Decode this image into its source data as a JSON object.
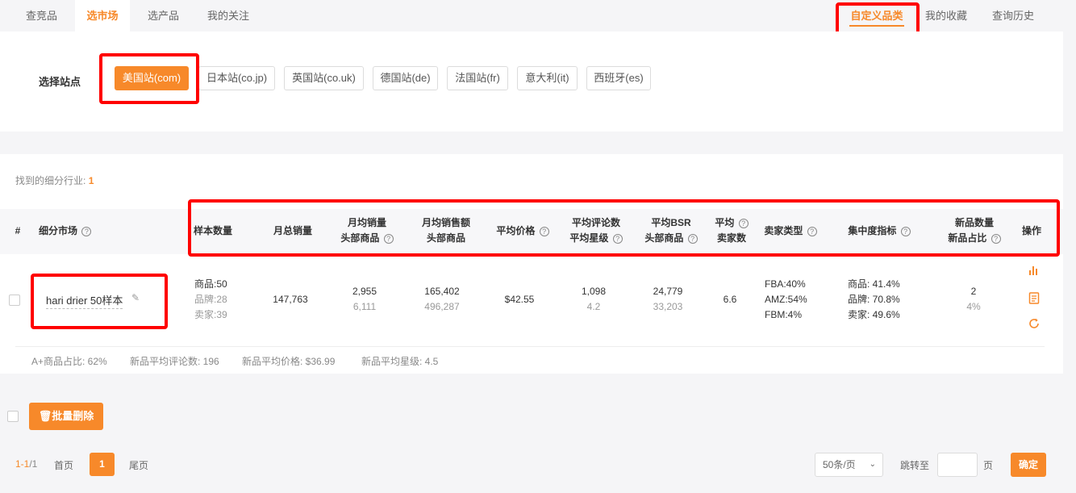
{
  "nav": {
    "tabs": [
      "查竞品",
      "选市场",
      "选产品",
      "我的关注"
    ],
    "right_tabs": [
      "自定义品类",
      "我的收藏",
      "查询历史"
    ]
  },
  "site": {
    "label": "选择站点",
    "options": [
      "美国站(com)",
      "日本站(co.jp)",
      "英国站(co.uk)",
      "德国站(de)",
      "法国站(fr)",
      "意大利(it)",
      "西班牙(es)"
    ],
    "selected": "美国站(com)"
  },
  "results": {
    "found_label": "找到的细分行业:",
    "found_count": "1"
  },
  "table": {
    "headers": {
      "index": "#",
      "market": "细分市场",
      "sample": "样本数量",
      "monthly_sales": "月总销量",
      "avg_sales_1": "月均销量",
      "avg_sales_2": "头部商品",
      "avg_revenue_1": "月均销售额",
      "avg_revenue_2": "头部商品",
      "avg_price": "平均价格",
      "avg_reviews_1": "平均评论数",
      "avg_reviews_2": "平均星级",
      "avg_bsr_1": "平均BSR",
      "avg_bsr_2": "头部商品",
      "avg_sellers_1": "平均",
      "avg_sellers_2": "卖家数",
      "seller_type": "卖家类型",
      "concentration": "集中度指标",
      "new_1": "新品数量",
      "new_2": "新品占比",
      "ops": "操作"
    },
    "rows": [
      {
        "market": "hari drier 50样本",
        "sample_products": "商品:50",
        "sample_brands": "品牌:28",
        "sample_sellers": "卖家:39",
        "monthly_sales": "147,763",
        "avg_sales": "2,955",
        "avg_sales_top": "6,111",
        "avg_revenue": "165,402",
        "avg_revenue_top": "496,287",
        "avg_price": "$42.55",
        "avg_reviews": "1,098",
        "avg_rating": "4.2",
        "avg_bsr": "24,779",
        "avg_bsr_top": "33,203",
        "avg_sellers": "6.6",
        "fba": "FBA:40%",
        "amz": "AMZ:54%",
        "fbm": "FBM:4%",
        "conc_products": "商品: 41.4%",
        "conc_brands": "品牌: 70.8%",
        "conc_sellers": "卖家: 49.6%",
        "new_count": "2",
        "new_ratio": "4%"
      }
    ],
    "summary": {
      "aplus": "A+商品占比: 62%",
      "new_reviews": "新品平均评论数: 196",
      "new_price": "新品平均价格: $36.99",
      "new_rating": "新品平均星级: 4.5"
    }
  },
  "bulk_delete": "批量删除",
  "pager": {
    "range": "1-1",
    "total": "/1",
    "first": "首页",
    "current": "1",
    "last": "尾页",
    "per_page": "50条/页",
    "jump_to": "跳转至",
    "page_unit": "页",
    "confirm": "确定"
  },
  "colors": {
    "accent": "#f7892a",
    "highlight": "#ff0000"
  }
}
